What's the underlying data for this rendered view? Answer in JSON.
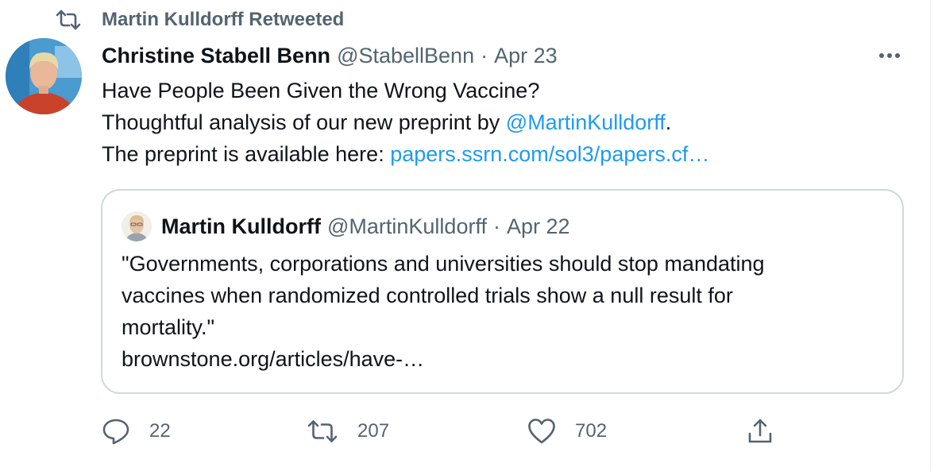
{
  "retweet": {
    "label": "Martin Kulldorff Retweeted",
    "icon": "retweet-icon"
  },
  "tweet": {
    "author_name": "Christine Stabell Benn",
    "author_handle": "@StabellBenn",
    "separator": "·",
    "date": "Apr 23",
    "more_icon": "more-icon",
    "lines": {
      "line1": "Have People Been Given the Wrong Vaccine?",
      "line2_prefix": "Thoughtful analysis of our new preprint by ",
      "line2_mention": "@MartinKulldorff",
      "line2_suffix": ".",
      "line3_prefix": "The preprint is available here: ",
      "line3_link": "papers.ssrn.com/sol3/papers.cf…"
    }
  },
  "quote": {
    "author_name": "Martin Kulldorff",
    "author_handle": "@MartinKulldorff",
    "separator": "·",
    "date": "Apr 22",
    "lines": [
      "\"Governments, corporations and universities should stop mandating",
      "vaccines when randomized controlled trials show a null result for",
      "mortality.\"",
      "brownstone.org/articles/have-…"
    ]
  },
  "actions": {
    "reply": {
      "icon": "reply-icon",
      "count": "22"
    },
    "retweet": {
      "icon": "retweet-icon",
      "count": "207"
    },
    "like": {
      "icon": "heart-icon",
      "count": "702"
    },
    "share": {
      "icon": "share-icon"
    }
  },
  "colors": {
    "text": "#0f1419",
    "secondary": "#536471",
    "link": "#1d9bf0",
    "border": "#cfd9de"
  }
}
